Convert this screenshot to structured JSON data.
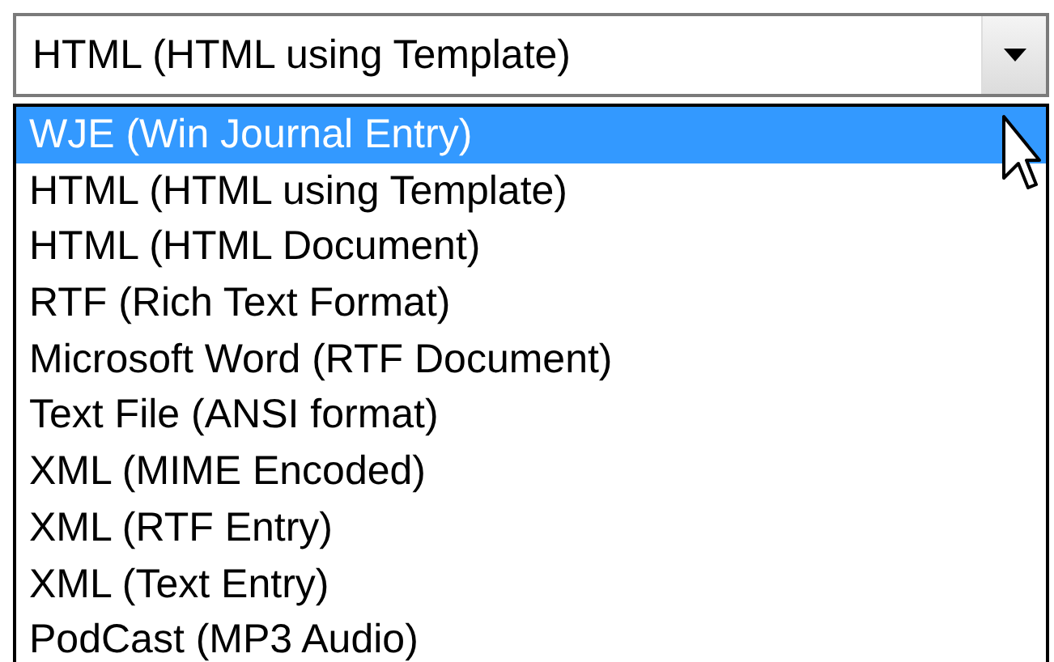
{
  "combo": {
    "value": "HTML (HTML using Template)"
  },
  "options": [
    {
      "label": "WJE (Win Journal Entry)",
      "selected": true
    },
    {
      "label": "HTML (HTML using Template)",
      "selected": false
    },
    {
      "label": "HTML (HTML Document)",
      "selected": false
    },
    {
      "label": "RTF (Rich Text Format)",
      "selected": false
    },
    {
      "label": "Microsoft Word (RTF Document)",
      "selected": false
    },
    {
      "label": "Text File (ANSI format)",
      "selected": false
    },
    {
      "label": "XML (MIME Encoded)",
      "selected": false
    },
    {
      "label": "XML (RTF Entry)",
      "selected": false
    },
    {
      "label": "XML (Text Entry)",
      "selected": false
    },
    {
      "label": "PodCast (MP3 Audio)",
      "selected": false
    }
  ]
}
